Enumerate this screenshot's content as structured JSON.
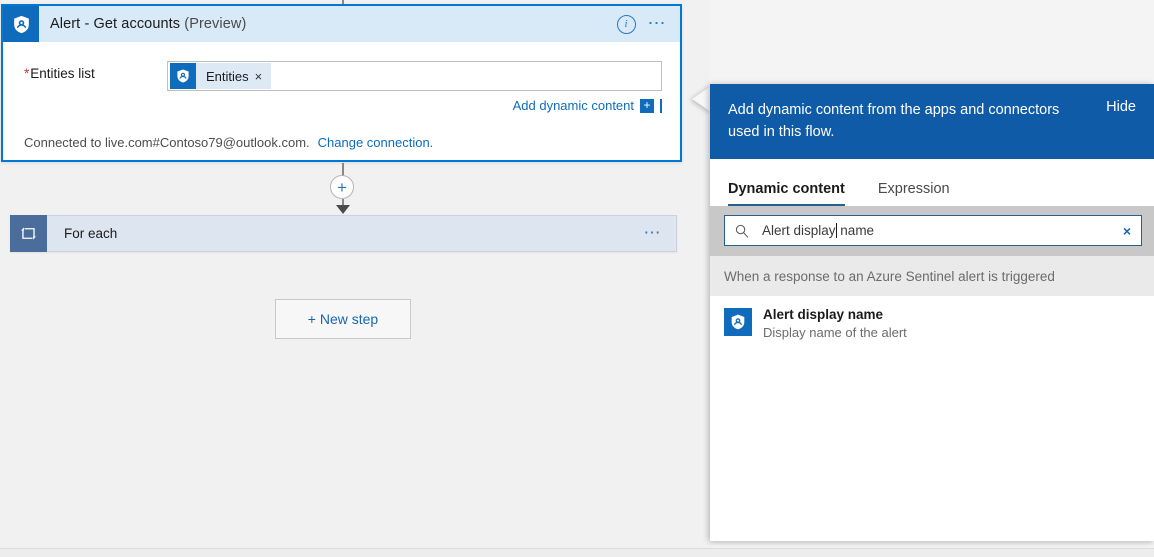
{
  "canvas": {
    "action_card": {
      "icon": "azure-sentinel-shield-icon",
      "title": "Alert - Get accounts ",
      "title_suffix": "(Preview)",
      "info_icon": "info-icon",
      "more_icon": "ellipsis-icon",
      "field": {
        "required_marker": "*",
        "label": "Entities list",
        "token_label": "Entities",
        "token_remove": "×",
        "token_icon": "azure-sentinel-shield-icon"
      },
      "add_dynamic_content": "Add dynamic content",
      "add_dynamic_plus": "+",
      "connected_text": "Connected to live.com#Contoso79@outlook.com.",
      "change_connection": "Change connection."
    },
    "connector": {
      "plus_label": "+",
      "plus_icon": "add-step-icon",
      "arrow_icon": "arrow-down-icon"
    },
    "foreach_card": {
      "icon": "loop-repeat-icon",
      "title": "For each",
      "more_icon": "ellipsis-icon"
    },
    "new_step_button": "+ New step"
  },
  "dynamic_panel": {
    "header_text": "Add dynamic content from the apps and connectors used in this flow.",
    "hide_label": "Hide",
    "tabs": [
      {
        "label": "Dynamic content",
        "active": true
      },
      {
        "label": "Expression",
        "active": false
      }
    ],
    "search": {
      "icon": "search-icon",
      "value_before_caret": "Alert display",
      "value_after_caret": " name",
      "full_value": "Alert display name",
      "clear_icon": "clear-x-icon",
      "clear_label": "×"
    },
    "group_header": "When a response to an Azure Sentinel alert is triggered",
    "items": [
      {
        "icon": "azure-sentinel-shield-icon",
        "title": "Alert display name",
        "subtitle": "Display name of the alert"
      }
    ]
  },
  "colors": {
    "accent_blue": "#0f6cbd",
    "panel_header_blue": "#0f5ba7",
    "card_header_blue": "#d8e9f7",
    "selected_border": "#0078d4",
    "link_blue": "#1866ad",
    "required_red": "#d13438",
    "foreach_icon": "#4a6d9b",
    "search_band_gray": "#c8c8c8",
    "group_header_gray": "#eaeaea",
    "canvas_gray": "#f1f1f1"
  }
}
